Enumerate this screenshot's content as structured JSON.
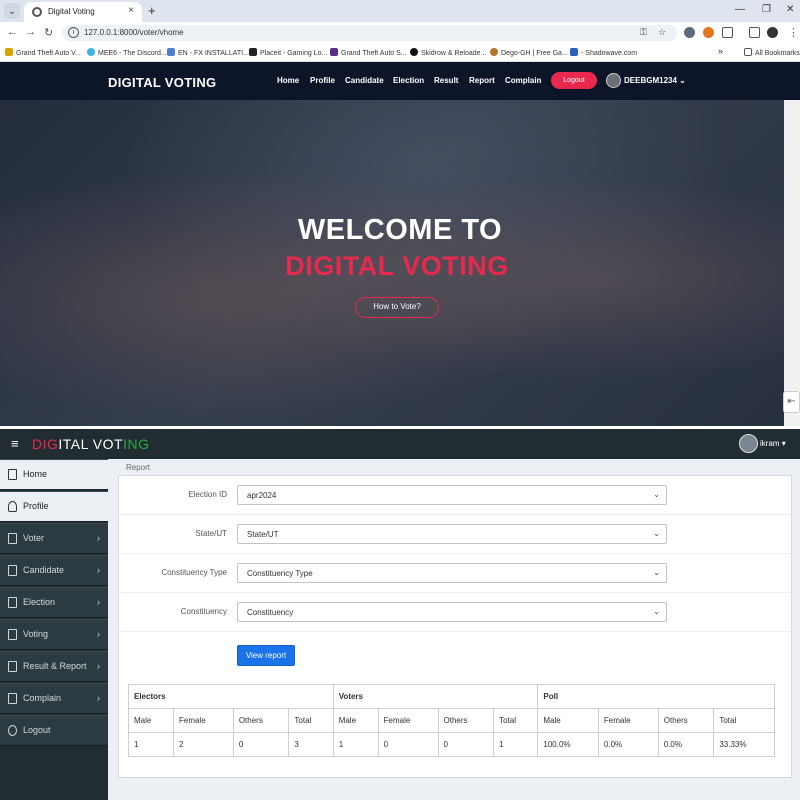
{
  "browser": {
    "tab_title": "Digital Voting",
    "url": "127.0.0.1:8000/voter/vhome",
    "bookmarks": [
      "Grand Theft Auto V...",
      "MEE6 - The Discord...",
      "EN - FX INSTALLATI...",
      "Placeit - Gaming Lo...",
      "Grand Theft Auto S...",
      "Skidrow & Reloade...",
      "Dego-GH | Free Ga...",
      "- Shadowave.com"
    ],
    "all_bookmarks": "All Bookmarks",
    "overflow": "»"
  },
  "site": {
    "brand": "DIGITAL VOTING",
    "nav": [
      "Home",
      "Profile",
      "Candidate",
      "Election",
      "Result",
      "Report",
      "Complain"
    ],
    "logout": "Logout",
    "user": "DEEBGM1234",
    "hero_line1": "WELCOME TO",
    "hero_line2": "DIGITAL VOTING",
    "hero_button": "How to Vote?"
  },
  "admin": {
    "brand_a": "DIG",
    "brand_b": "ITAL VOT",
    "brand_c": "ING",
    "user": "ikram",
    "breadcrumb": "Report",
    "sidebar": [
      {
        "label": "Home",
        "arrow": ""
      },
      {
        "label": "Profile",
        "arrow": ""
      },
      {
        "label": "Voter",
        "arrow": "›"
      },
      {
        "label": "Candidate",
        "arrow": "›"
      },
      {
        "label": "Election",
        "arrow": "›"
      },
      {
        "label": "Voting",
        "arrow": "›"
      },
      {
        "label": "Result & Report",
        "arrow": "›"
      },
      {
        "label": "Complain",
        "arrow": "›"
      },
      {
        "label": "Logout",
        "arrow": ""
      }
    ],
    "form": {
      "election_label": "Election ID",
      "election_value": "apr2024",
      "state_label": "State/UT",
      "state_value": "State/UT",
      "ctype_label": "Constituency Type",
      "ctype_value": "Constituency Type",
      "const_label": "Constituency",
      "const_value": "Constituency",
      "view_button": "View report"
    },
    "table": {
      "groups": [
        "Electors",
        "Voters",
        "Poll"
      ],
      "headers": [
        "Male",
        "Female",
        "Others",
        "Total",
        "Male",
        "Female",
        "Others",
        "Total",
        "Male",
        "Female",
        "Others",
        "Total"
      ],
      "row": [
        "1",
        "2",
        "0",
        "3",
        "1",
        "0",
        "0",
        "1",
        "100.0%",
        "0.0%",
        "0.0%",
        "33.33%"
      ]
    }
  },
  "colors": {
    "accent_red": "#e8284d",
    "nav_dark": "#0d1529",
    "admin_dark": "#222d32",
    "primary_blue": "#1a73e8"
  }
}
